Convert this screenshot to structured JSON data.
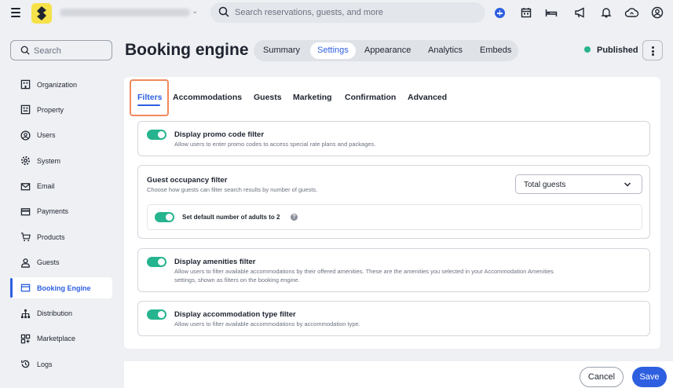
{
  "topbar": {
    "search_placeholder": "Search reservations, guests, and more",
    "icons": [
      "menu-icon",
      "add-icon",
      "calendar-icon",
      "bed-icon",
      "megaphone-icon",
      "bell-icon",
      "cloud-sync-icon",
      "account-icon"
    ]
  },
  "sidebar": {
    "search_placeholder": "Search",
    "items": [
      {
        "label": "Organization",
        "icon": "organization-icon"
      },
      {
        "label": "Property",
        "icon": "property-icon"
      },
      {
        "label": "Users",
        "icon": "user-icon"
      },
      {
        "label": "System",
        "icon": "gear-icon"
      },
      {
        "label": "Email",
        "icon": "mail-icon"
      },
      {
        "label": "Payments",
        "icon": "credit-card-icon"
      },
      {
        "label": "Products",
        "icon": "cart-icon"
      },
      {
        "label": "Guests",
        "icon": "guests-icon"
      },
      {
        "label": "Booking Engine",
        "icon": "booking-engine-icon",
        "active": true
      },
      {
        "label": "Distribution",
        "icon": "distribution-icon"
      },
      {
        "label": "Marketplace",
        "icon": "marketplace-icon"
      },
      {
        "label": "Logs",
        "icon": "history-icon"
      }
    ]
  },
  "header": {
    "title": "Booking engine",
    "tabs": [
      "Summary",
      "Settings",
      "Appearance",
      "Analytics",
      "Embeds"
    ],
    "active_tab": "Settings",
    "status": "Published"
  },
  "subtabs": {
    "items": [
      "Filters",
      "Accommodations",
      "Guests",
      "Marketing",
      "Confirmation",
      "Advanced"
    ],
    "active": "Filters"
  },
  "filters": {
    "promo": {
      "title": "Display promo code filter",
      "desc": "Allow users to enter promo codes to access special rate plans and packages.",
      "enabled": true
    },
    "occupancy": {
      "title": "Guest occupancy filter",
      "desc": "Choose how guests can filter search results by number of guests.",
      "select_value": "Total guests",
      "default_adults_label": "Set default number of adults to 2",
      "default_adults_enabled": true
    },
    "amenities": {
      "title": "Display amenities filter",
      "desc_line1": "Allow users to filter available accommodations by their offered amenities. These are the amenities you selected in your Accommodation Amenities",
      "desc_line2": "settings, shown as filters on the booking engine.",
      "enabled": true
    },
    "accommodation_type": {
      "title": "Display accommodation type filter",
      "desc": "Allow users to filter available accommodations by accommodation type.",
      "enabled": true
    }
  },
  "footer": {
    "cancel_label": "Cancel",
    "save_label": "Save"
  },
  "colors": {
    "accent": "#2d5fe0",
    "toggle_on": "#26b48f",
    "highlight": "#f08a5d"
  }
}
